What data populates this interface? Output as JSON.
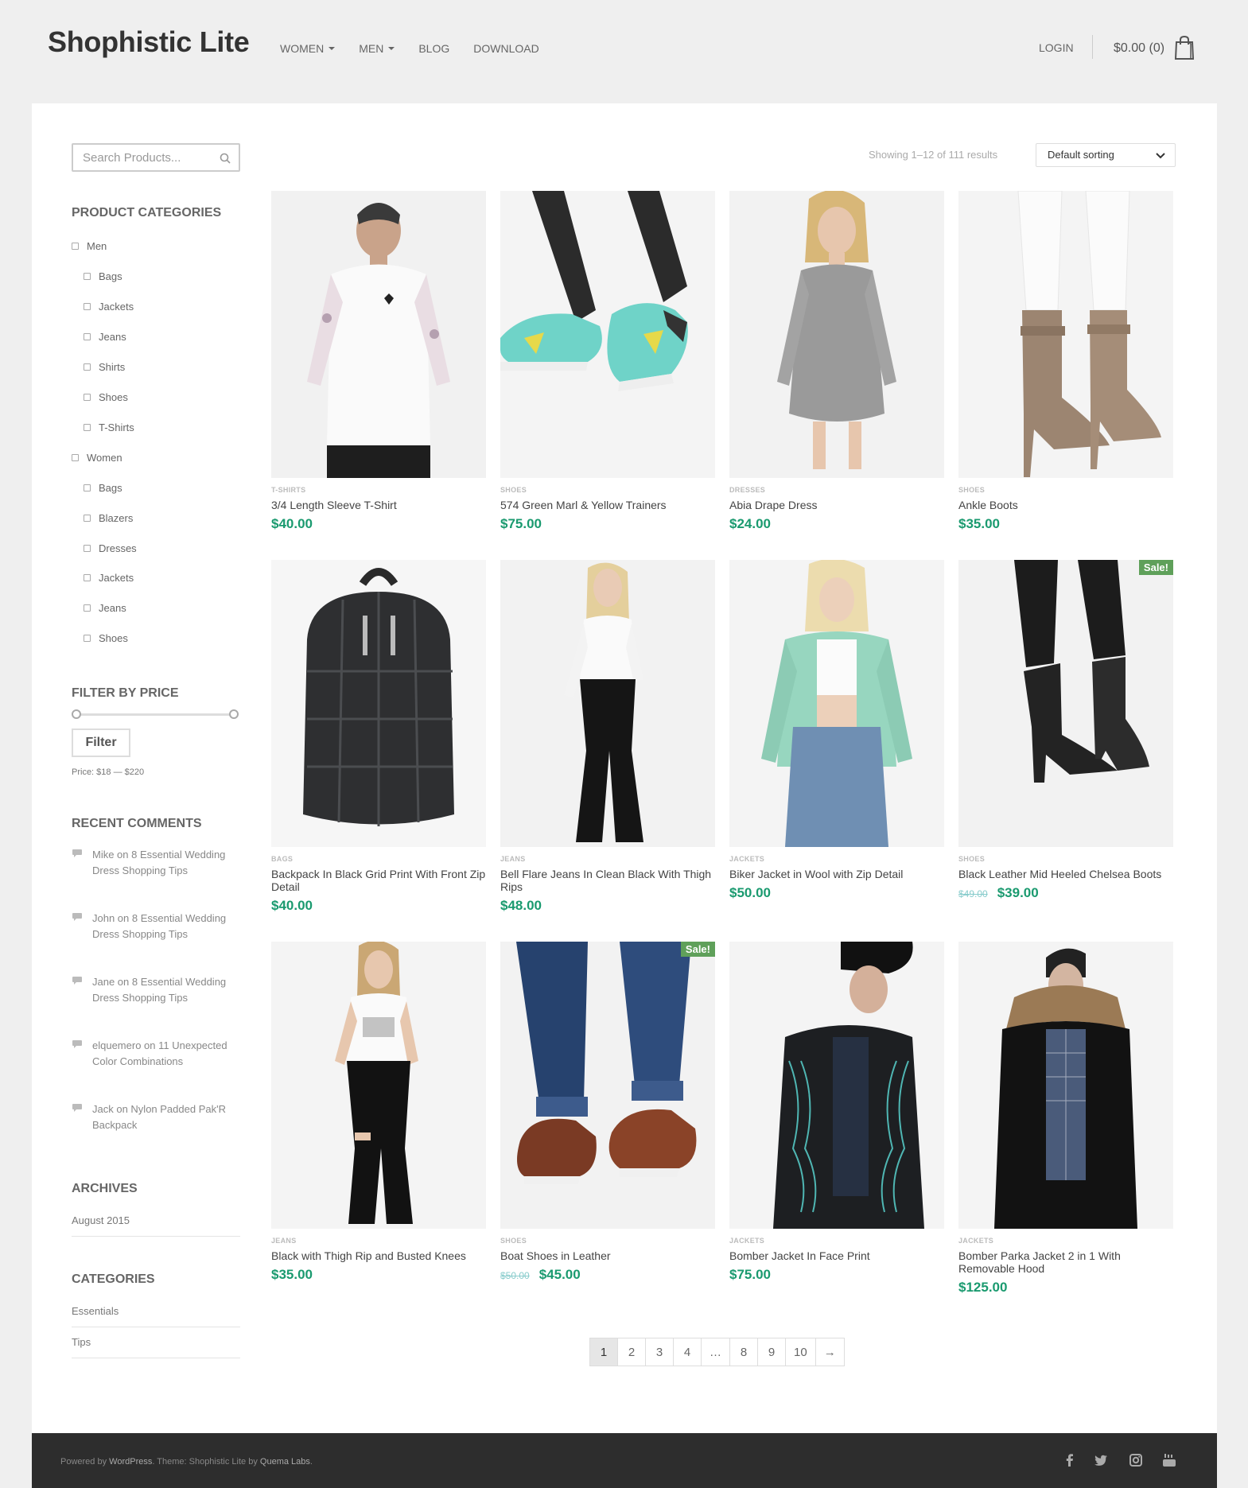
{
  "header": {
    "site_title": "Shophistic Lite",
    "nav": [
      {
        "label": "WOMEN",
        "dropdown": true
      },
      {
        "label": "MEN",
        "dropdown": true
      },
      {
        "label": "BLOG",
        "dropdown": false
      },
      {
        "label": "DOWNLOAD",
        "dropdown": false
      }
    ],
    "login": "LOGIN",
    "cart_total": "$0.00 (0)"
  },
  "sidebar": {
    "search_placeholder": "Search Products...",
    "product_categories_title": "PRODUCT CATEGORIES",
    "categories": [
      {
        "label": "Men"
      },
      {
        "label": "Bags"
      },
      {
        "label": "Jackets"
      },
      {
        "label": "Jeans"
      },
      {
        "label": "Shirts"
      },
      {
        "label": "Shoes"
      },
      {
        "label": "T-Shirts"
      },
      {
        "label": "Women"
      },
      {
        "label": "Bags"
      },
      {
        "label": "Blazers"
      },
      {
        "label": "Dresses"
      },
      {
        "label": "Jackets"
      },
      {
        "label": "Jeans"
      },
      {
        "label": "Shoes"
      }
    ],
    "filter_title": "FILTER BY PRICE",
    "filter_button": "Filter",
    "price_range": "Price: $18 — $220",
    "recent_comments_title": "RECENT COMMENTS",
    "recent_comments": [
      "Mike on 8 Essential Wedding Dress Shopping Tips",
      "John on 8 Essential Wedding Dress Shopping Tips",
      "Jane on 8 Essential Wedding Dress Shopping Tips",
      "elquemero on 11 Unexpected Color Combinations",
      "Jack on Nylon Padded Pak'R Backpack"
    ],
    "archives_title": "ARCHIVES",
    "archives": [
      "August 2015"
    ],
    "categories_title": "CATEGORIES",
    "blog_categories": [
      "Essentials",
      "Tips"
    ]
  },
  "toolbar": {
    "result_count": "Showing 1–12 of 111 results",
    "sort_label": "Default sorting"
  },
  "products": [
    {
      "category": "T-SHIRTS",
      "name": "3/4 Length Sleeve T-Shirt",
      "price": "$40.00",
      "old_price": "",
      "sale": false
    },
    {
      "category": "SHOES",
      "name": "574 Green Marl & Yellow Trainers",
      "price": "$75.00",
      "old_price": "",
      "sale": false
    },
    {
      "category": "DRESSES",
      "name": "Abia Drape Dress",
      "price": "$24.00",
      "old_price": "",
      "sale": false
    },
    {
      "category": "SHOES",
      "name": "Ankle Boots",
      "price": "$35.00",
      "old_price": "",
      "sale": false
    },
    {
      "category": "BAGS",
      "name": "Backpack In Black Grid Print With Front Zip Detail",
      "price": "$40.00",
      "old_price": "",
      "sale": false
    },
    {
      "category": "JEANS",
      "name": "Bell Flare Jeans In Clean Black With Thigh Rips",
      "price": "$48.00",
      "old_price": "",
      "sale": false
    },
    {
      "category": "JACKETS",
      "name": "Biker Jacket in Wool with Zip Detail",
      "price": "$50.00",
      "old_price": "",
      "sale": false
    },
    {
      "category": "SHOES",
      "name": "Black Leather Mid Heeled Chelsea Boots",
      "price": "$39.00",
      "old_price": "$49.00",
      "sale": true
    },
    {
      "category": "JEANS",
      "name": "Black with Thigh Rip and Busted Knees",
      "price": "$35.00",
      "old_price": "",
      "sale": false
    },
    {
      "category": "SHOES",
      "name": "Boat Shoes in Leather",
      "price": "$45.00",
      "old_price": "$50.00",
      "sale": true
    },
    {
      "category": "JACKETS",
      "name": "Bomber Jacket In Face Print",
      "price": "$75.00",
      "old_price": "",
      "sale": false
    },
    {
      "category": "JACKETS",
      "name": "Bomber Parka Jacket 2 in 1 With Removable Hood",
      "price": "$125.00",
      "old_price": "",
      "sale": false
    }
  ],
  "sale_label": "Sale!",
  "pagination": [
    "1",
    "2",
    "3",
    "4",
    "…",
    "8",
    "9",
    "10",
    "→"
  ],
  "footer": {
    "powered_by": "Powered by",
    "wordpress": "WordPress",
    "theme": ". Theme: Shophistic Lite by",
    "author": "Quema Labs",
    "end": "."
  },
  "colors": {
    "accent_price": "#1a9a6f",
    "sale_badge": "#5fa05a",
    "footer_bg": "#2d2d2d"
  }
}
